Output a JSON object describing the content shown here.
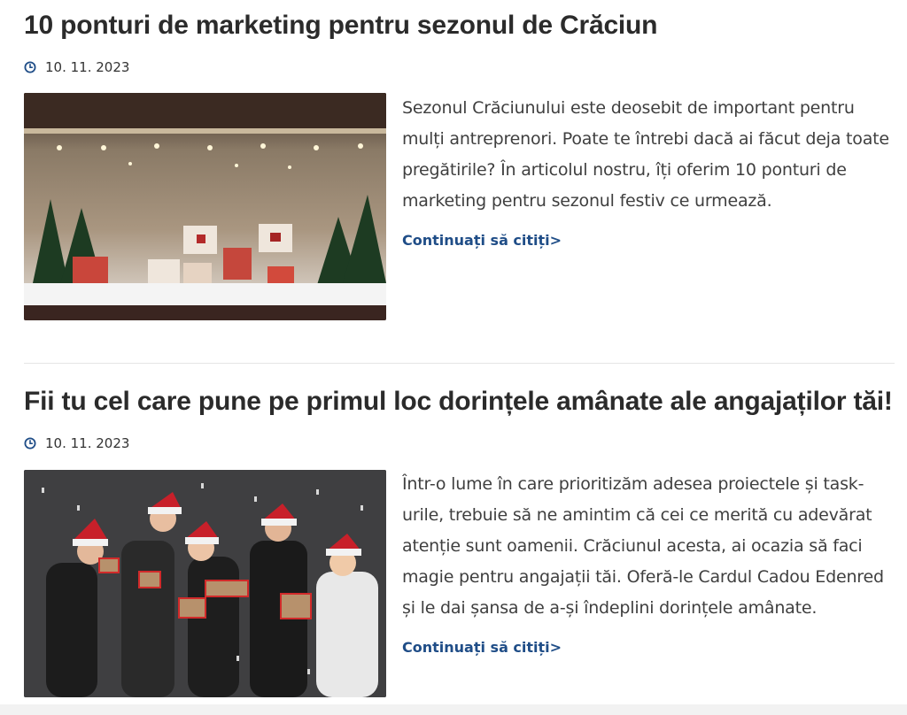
{
  "posts": [
    {
      "title": "10 ponturi de marketing pentru sezonul de Crăciun",
      "date": "10. 11. 2023",
      "image_alt": "store-window-with-christmas-handbags",
      "excerpt": "Sezonul Crăciunului este deosebit de important pentru mulți antreprenori. Poate te întrebi dacă ai făcut deja toate pregătirile? În articolul nostru, îți oferim 10 ponturi de marketing pentru sezonul festiv ce urmează.",
      "read_more": "Continuați să citiți>"
    },
    {
      "title": "Fii tu cel care pune pe primul loc dorințele amânate ale angajaților tăi!",
      "date": "10. 11. 2023",
      "image_alt": "group-with-santa-hats-holding-gifts",
      "excerpt": "Într-o lume în care prioritizăm adesea proiectele și task-urile, trebuie să ne amintim că cei ce merită cu adevărat atenție sunt oamenii. Crăciunul acesta, ai ocazia să faci magie pentru angajații tăi. Oferă-le Cardul Cadou Edenred și le dai șansa de a-și îndeplini dorințele amânate.",
      "read_more": "Continuați să citiți>"
    }
  ],
  "colors": {
    "title": "#2b2b2b",
    "link": "#1f4d87",
    "clock_icon": "#1f4d87",
    "divider": "#e5e5e5"
  }
}
